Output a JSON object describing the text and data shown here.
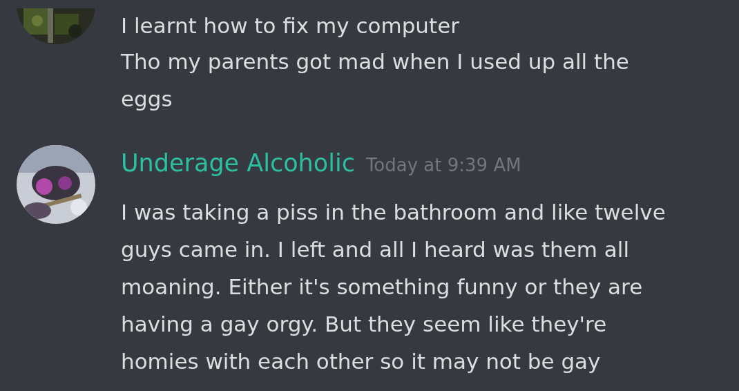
{
  "messages": [
    {
      "kind": "continuation",
      "lines": [
        "I learnt how to fix my computer",
        "Tho my parents got mad when I used up all the eggs"
      ]
    },
    {
      "kind": "full",
      "author": "Underage Alcoholic",
      "timestamp": "Today at 9:39 AM",
      "lines": [
        "I was taking a piss in the bathroom and like twelve guys came in. I left and all I heard was them all moaning. Either it's something funny or they are having a gay orgy. But they seem like they're homies with each other so it may not be gay"
      ]
    }
  ]
}
